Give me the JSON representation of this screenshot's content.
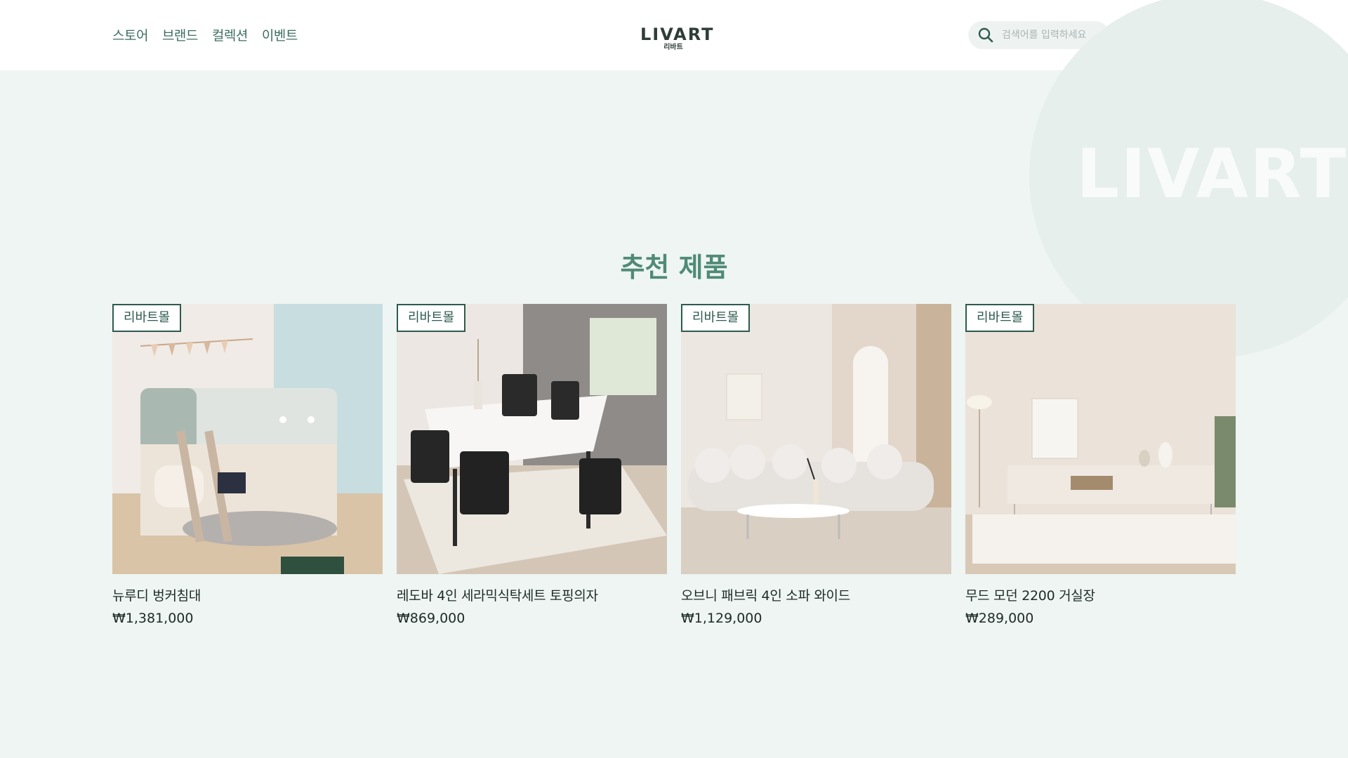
{
  "header": {
    "nav": [
      "스토어",
      "브랜드",
      "컬렉션",
      "이벤트"
    ],
    "logo": {
      "main": "LIVART",
      "sub": "리바트"
    },
    "search": {
      "placeholder": "검색어를 입력하세요",
      "value": ""
    },
    "icons": [
      "search-icon",
      "user-icon",
      "heart-icon",
      "shopping-bag-icon"
    ]
  },
  "hero": {
    "watermark": "LIVART"
  },
  "recommended": {
    "title": "추천 제품",
    "products": [
      {
        "badge": "리바트몰",
        "name": "뉴루디 벙커침대",
        "price": "₩1,381,000",
        "image": "bunk-bed-photo"
      },
      {
        "badge": "리바트몰",
        "name": "레도바 4인 세라믹식탁세트 토핑의자",
        "price": "₩869,000",
        "image": "dining-set-photo"
      },
      {
        "badge": "리바트몰",
        "name": "오브니 패브릭 4인 소파 와이드",
        "price": "₩1,129,000",
        "image": "sofa-photo"
      },
      {
        "badge": "리바트몰",
        "name": "무드 모던 2200 거실장",
        "price": "₩289,000",
        "image": "tv-stand-photo"
      }
    ]
  },
  "colors": {
    "page_bg": "#eef5f3",
    "accent": "#4f8a77",
    "badge_border": "#2d5a4e",
    "nav_text": "#3d6e63"
  }
}
